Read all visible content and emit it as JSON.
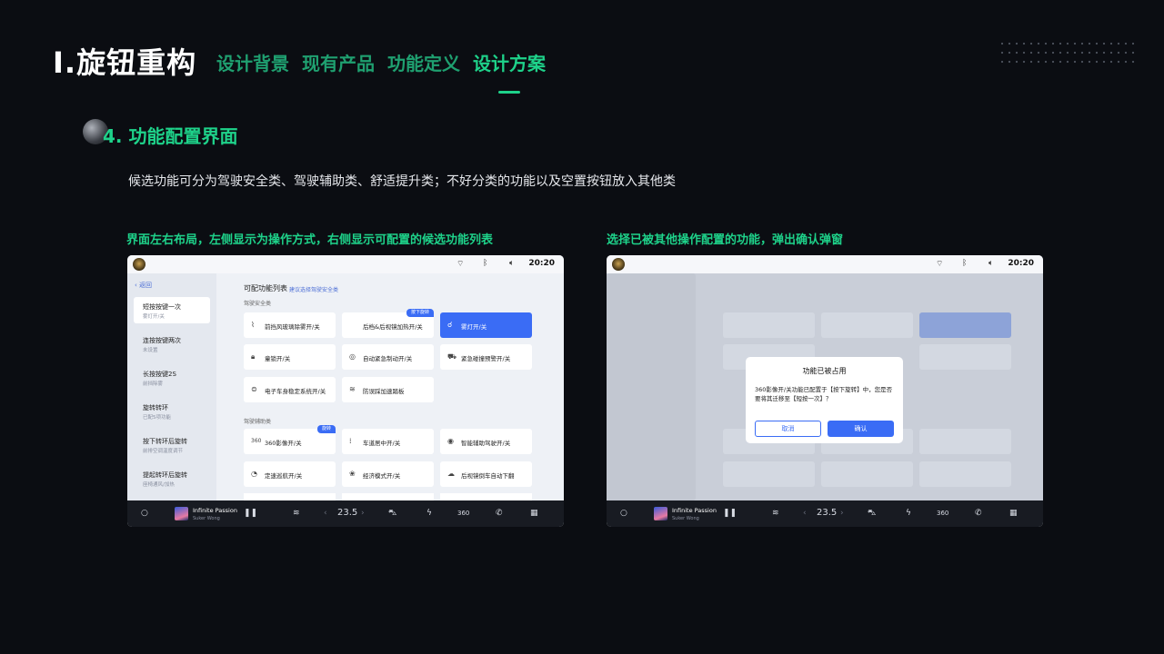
{
  "header": {
    "brand": "I.旋钮重构",
    "tabs": [
      {
        "label": "设计背景"
      },
      {
        "label": "现有产品"
      },
      {
        "label": "功能定义"
      },
      {
        "label": "设计方案"
      }
    ],
    "active_tab": 3
  },
  "section": {
    "title": "4. 功能配置界面",
    "description": "候选功能可分为驾驶安全类、驾驶辅助类、舒适提升类；不好分类的功能以及空置按钮放入其他类"
  },
  "captions": {
    "left": "界面左右布局，左侧显示为操作方式，右侧显示可配置的候选功能列表",
    "right": "选择已被其他操作配置的功能，弹出确认弹窗"
  },
  "screen": {
    "status": {
      "time": "20:20",
      "wifi_icon": "wifi-icon",
      "bluetooth_icon": "bluetooth-icon",
      "volume_icon": "volume-icon"
    },
    "back_label": "返回",
    "left_items": [
      {
        "title": "短按按键一次",
        "sub": "雾灯开/关"
      },
      {
        "title": "连按按键两次",
        "sub": "未设置"
      },
      {
        "title": "长按按键2S",
        "sub": "前挡除雾"
      },
      {
        "title": "旋转转环",
        "sub": "已配5项功能"
      },
      {
        "title": "按下转环后旋转",
        "sub": "前排空调温度调节"
      },
      {
        "title": "提起转环后旋转",
        "sub": "座椅通风/加热"
      }
    ],
    "list_title": "可配功能列表",
    "list_hint": "建议选择驾驶安全类",
    "categories": [
      "驾驶安全类",
      "驾驶辅助类"
    ],
    "safety_functions": [
      {
        "label": "前挡风玻璃除雾开/关",
        "icon": "defrost-icon"
      },
      {
        "label": "后档&后视镜加热开/关",
        "icon": "rear-defrost-icon",
        "tag": "按下旋转"
      },
      {
        "label": "雾灯开/关",
        "icon": "fog-light-icon"
      },
      {
        "label": "童锁开/关",
        "icon": "child-lock-icon"
      },
      {
        "label": "自动紧急制动开/关",
        "icon": "emergency-brake-icon"
      },
      {
        "label": "紧急碰撞预警开/关",
        "icon": "collision-warning-icon"
      },
      {
        "label": "电子车身稳定系统开/关",
        "icon": "esp-icon"
      },
      {
        "label": "防误踩加速踏板",
        "icon": "pedal-icon"
      }
    ],
    "assist_functions": [
      {
        "label": "360影像开/关",
        "icon": "camera-360-icon",
        "tag": "旋转"
      },
      {
        "label": "车道居中开/关",
        "icon": "lane-center-icon"
      },
      {
        "label": "智能辅助驾驶开/关",
        "icon": "smart-drive-icon"
      },
      {
        "label": "定速巡航开/关",
        "icon": "cruise-icon"
      },
      {
        "label": "经济模式开/关",
        "icon": "eco-icon"
      },
      {
        "label": "后视镜倒车自动下翻",
        "icon": "mirror-icon"
      }
    ],
    "dock": {
      "song": "Infinite Passion",
      "artist": "Suker Wong",
      "temp": "23.5",
      "icons": [
        "home-icon",
        "pause-icon",
        "fan-icon",
        "chevron-left-icon",
        "chevron-right-icon",
        "car-icon",
        "flash-icon",
        "camera-360-icon",
        "phone-icon",
        "apps-icon"
      ]
    }
  },
  "dialog": {
    "title": "功能已被占用",
    "message": "360影像开/关功能已配置于【按下旋转】中，您是否要将其迁移至【短按一次】？",
    "cancel": "取消",
    "confirm": "确认"
  }
}
